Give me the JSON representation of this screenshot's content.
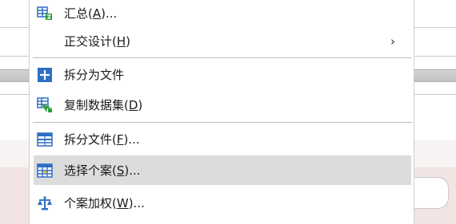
{
  "colors": {
    "menu_bg": "#ffffff",
    "highlight": "#dcdcdc",
    "icon_blue": "#2e6fc4",
    "icon_green": "#2f9e3a",
    "background_pink": "#f1e4e2"
  },
  "menu": {
    "items": [
      {
        "text": "汇总(",
        "key": "A",
        "tail": ")...",
        "icon": "aggregate-icon"
      },
      {
        "text": "正交设计(",
        "key": "H",
        "tail": ")",
        "arrow": "›",
        "icon": ""
      },
      {
        "text": "拆分为文件",
        "key": "",
        "tail": "",
        "icon": "split-to-files-icon"
      },
      {
        "text": "复制数据集(",
        "key": "D",
        "tail": ")",
        "icon": "copy-dataset-icon"
      },
      {
        "text": "拆分文件(",
        "key": "F",
        "tail": ")...",
        "icon": "split-file-icon"
      },
      {
        "text": "选择个案(",
        "key": "S",
        "tail": ")...",
        "icon": "select-cases-icon",
        "highlighted": true
      },
      {
        "text": "个案加权(",
        "key": "W",
        "tail": ")...",
        "icon": "weight-cases-icon"
      }
    ]
  }
}
